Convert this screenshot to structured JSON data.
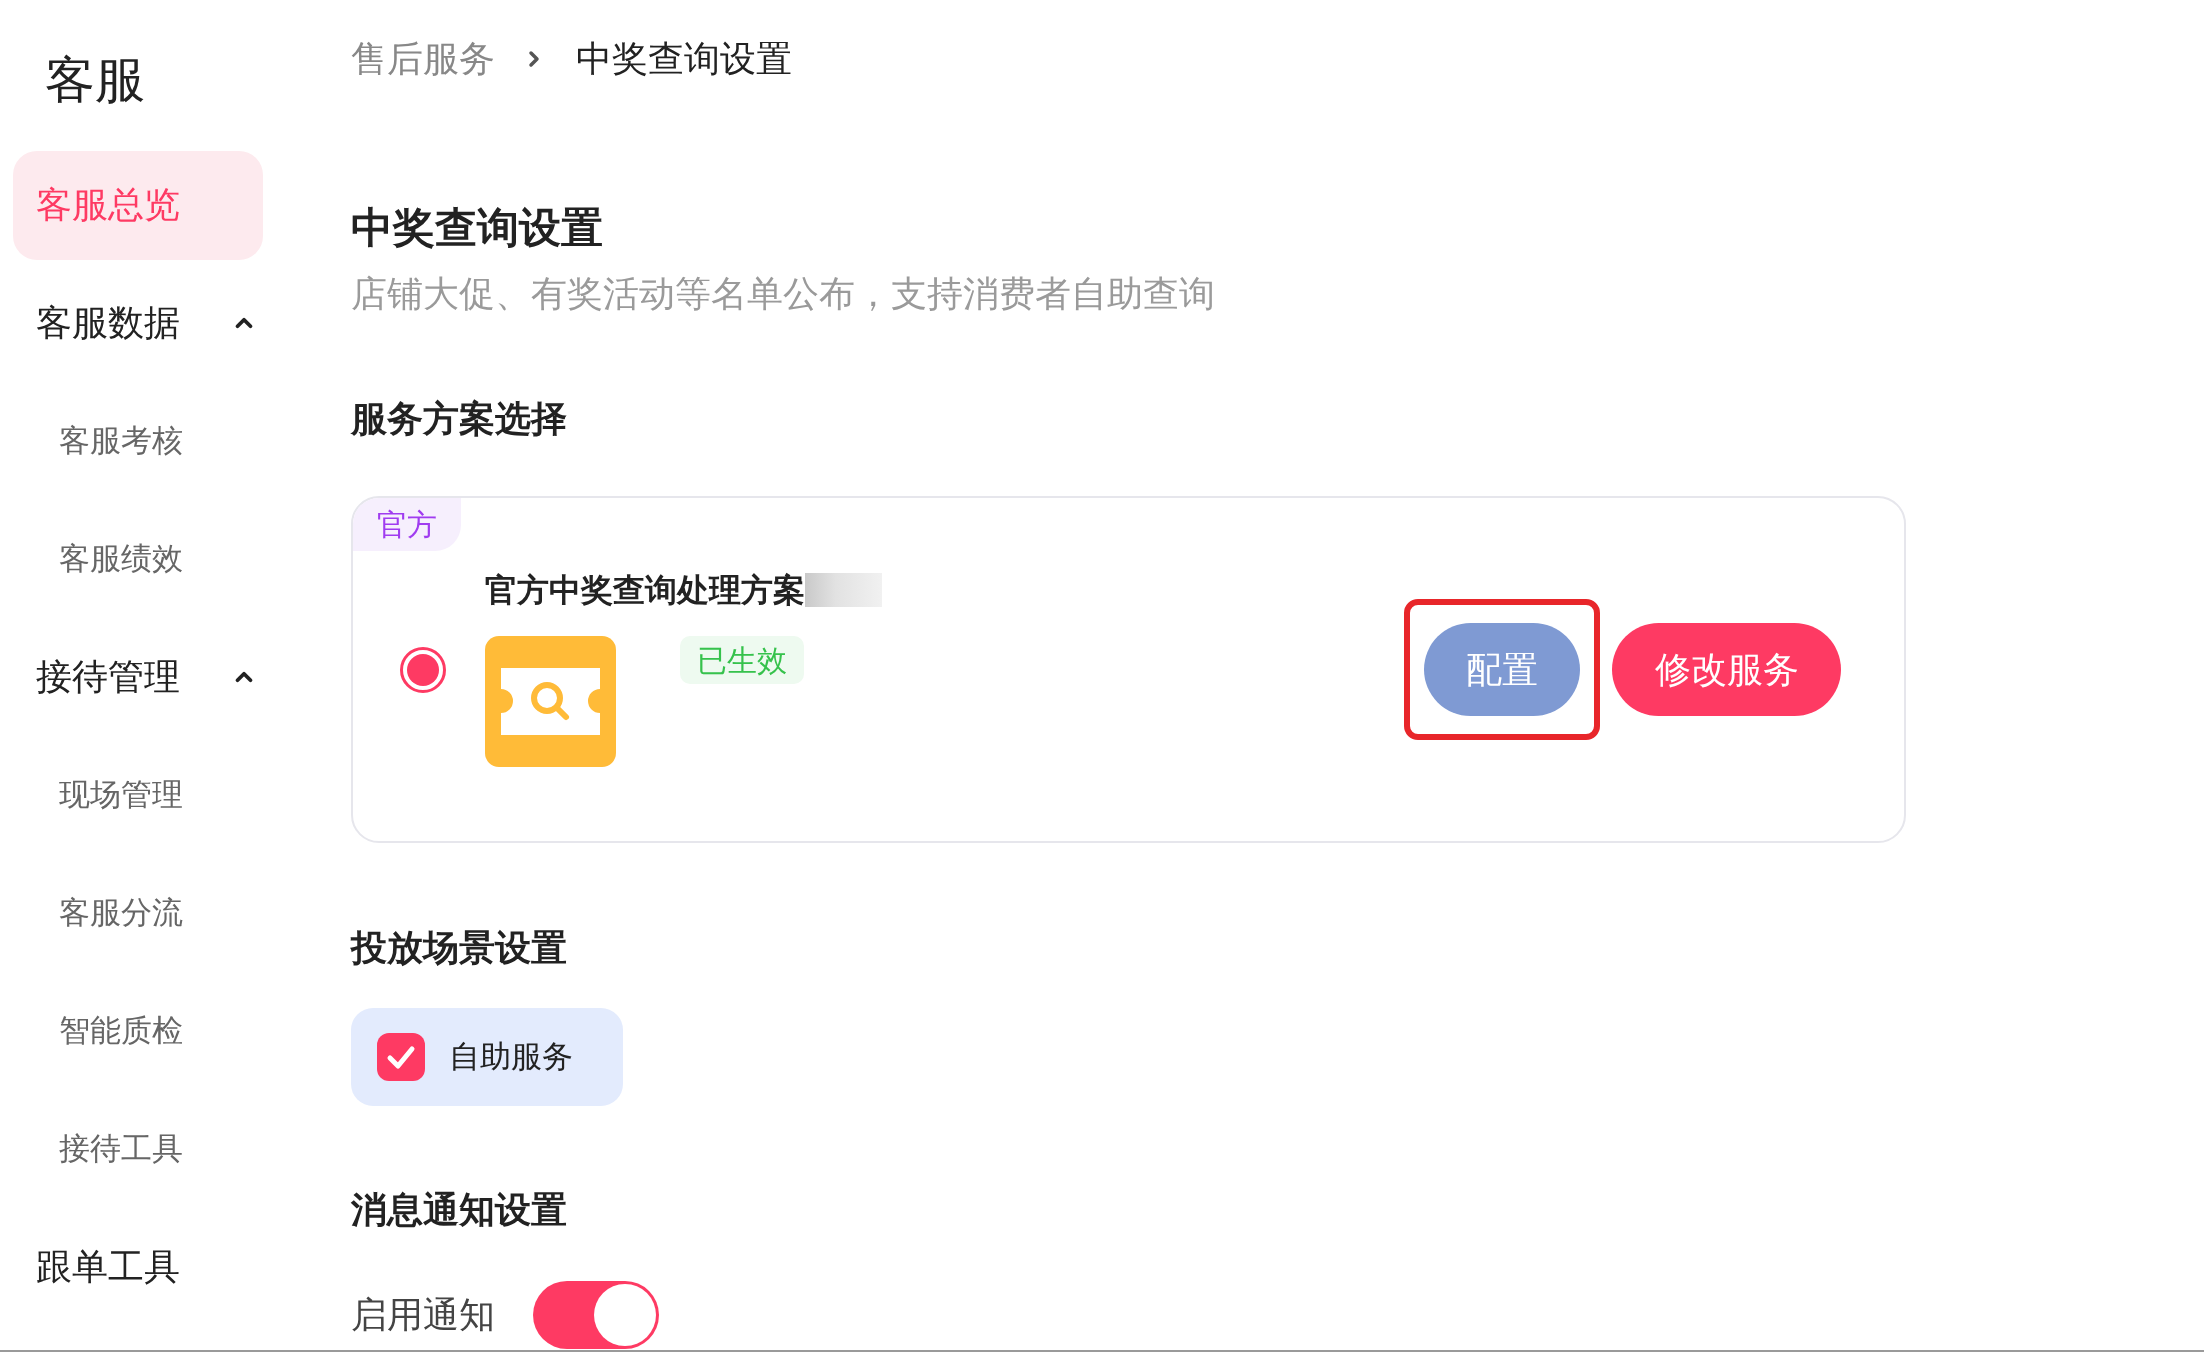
{
  "sidebar": {
    "title": "客服",
    "items": [
      {
        "kind": "page",
        "label": "客服总览",
        "selected": true
      },
      {
        "kind": "group",
        "label": "客服数据",
        "selected": false,
        "expanded": true,
        "children": [
          {
            "label": "客服考核",
            "selected": false
          },
          {
            "label": "客服绩效",
            "selected": false
          }
        ]
      },
      {
        "kind": "group",
        "label": "接待管理",
        "selected": false,
        "expanded": true,
        "children": [
          {
            "label": "现场管理",
            "selected": false
          },
          {
            "label": "客服分流",
            "selected": false
          },
          {
            "label": "智能质检",
            "selected": false
          },
          {
            "label": "接待工具",
            "selected": false
          }
        ]
      },
      {
        "kind": "page",
        "label": "跟单工具",
        "selected": false
      }
    ]
  },
  "breadcrumb": [
    {
      "label": "售后服务",
      "current": false
    },
    {
      "label": "中奖查询设置",
      "current": true
    }
  ],
  "page": {
    "title": "中奖查询设置",
    "subtitle": "店铺大促、有奖活动等名单公布，支持消费者自助查询"
  },
  "service_plan": {
    "heading": "服务方案选择",
    "plans": [
      {
        "badge": "官方",
        "name": "官方中奖查询处理方案",
        "redacted": true,
        "selected": true,
        "status": "已生效",
        "buttons": [
          {
            "kind": "secondary",
            "label": "配置",
            "highlighted": true
          },
          {
            "kind": "primary",
            "label": "修改服务",
            "highlighted": false
          }
        ]
      }
    ]
  },
  "scenes": {
    "heading": "投放场景设置",
    "options": [
      {
        "label": "自助服务",
        "checked": true
      }
    ]
  },
  "notifications": {
    "heading": "消息通知设置",
    "toggles": [
      {
        "label": "启用通知",
        "on": true
      }
    ]
  }
}
